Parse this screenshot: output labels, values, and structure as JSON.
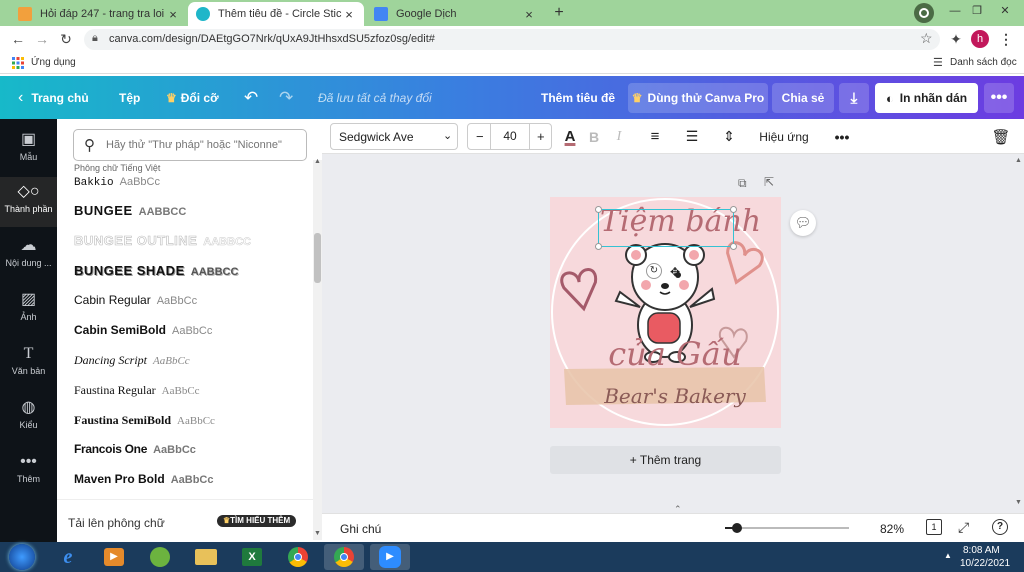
{
  "browser": {
    "tabs": [
      {
        "title": "Hỏi đáp 247 - trang tra loi",
        "active": false,
        "favicon_color": "#f2a03d"
      },
      {
        "title": "Thêm tiêu đề - Circle Sticker",
        "active": true,
        "favicon_color": "#1fb6c9"
      },
      {
        "title": "Google Dịch",
        "active": false,
        "favicon_color": "#4285f4"
      }
    ],
    "url": "canva.com/design/DAEtgGO7Nrk/qUxA9JtHhsxdSU5zfoz0sg/edit#",
    "profile_initial": "h",
    "bookmarks_label": "Ứng dụng",
    "reading_list_label": "Danh sách đọc"
  },
  "canva": {
    "topbar": {
      "home": "Trang chủ",
      "file": "Tệp",
      "resize": "Đổi cỡ",
      "saved": "Đã lưu tất cả thay đổi",
      "title": "Thêm tiêu đề",
      "try_pro": "Dùng thử Canva Pro",
      "share": "Chia sẻ",
      "print": "In nhãn dán"
    },
    "rail": [
      {
        "label": "Mẫu",
        "icon": "template-icon"
      },
      {
        "label": "Thành phần",
        "icon": "elements-icon"
      },
      {
        "label": "Nội dung ...",
        "icon": "upload-icon"
      },
      {
        "label": "Ảnh",
        "icon": "photo-icon"
      },
      {
        "label": "Văn bản",
        "icon": "text-icon"
      },
      {
        "label": "Kiểu",
        "icon": "style-icon"
      },
      {
        "label": "Thêm",
        "icon": "more-icon"
      }
    ],
    "font_panel": {
      "search_placeholder": "Hãy thử \"Thư pháp\" hoặc \"Niconne\"",
      "section": "Phông chữ Tiếng Việt",
      "fonts": [
        {
          "name": "Bakkio",
          "sample": "AaBbCc"
        },
        {
          "name": "BUNGEE",
          "sample": "AABBCC"
        },
        {
          "name": "BUNGEE OUTLINE",
          "sample": "AABBCC"
        },
        {
          "name": "BUNGEE SHADE",
          "sample": "AABBCC"
        },
        {
          "name": "Cabin Regular",
          "sample": "AaBbCc"
        },
        {
          "name": "Cabin SemiBold",
          "sample": "AaBbCc"
        },
        {
          "name": "Dancing Script",
          "sample": "AaBbCc"
        },
        {
          "name": "Faustina Regular",
          "sample": "AaBbCc"
        },
        {
          "name": "Faustina SemiBold",
          "sample": "AaBbCc"
        },
        {
          "name": "Francois One",
          "sample": "AaBbCc"
        },
        {
          "name": "Maven Pro Bold",
          "sample": "AaBbCc"
        }
      ],
      "upload": "Tải lên phông chữ",
      "learn_more": "TÌM HIỂU THÊM"
    },
    "toolbar": {
      "font": "Sedgwick Ave",
      "size": "40",
      "effects": "Hiệu ứng"
    },
    "design": {
      "line1": "Tiệm bánh",
      "line2": "của Gấu",
      "line3": "Bear's Bakery",
      "bg_color": "#f7d9dc",
      "text_color": "#b56b73"
    },
    "add_page": "+ Thêm trang",
    "bottom": {
      "notes": "Ghi chú",
      "zoom": "82%",
      "zoom_level": 0.1
    }
  },
  "taskbar": {
    "time": "8:08 AM",
    "date": "10/22/2021"
  }
}
